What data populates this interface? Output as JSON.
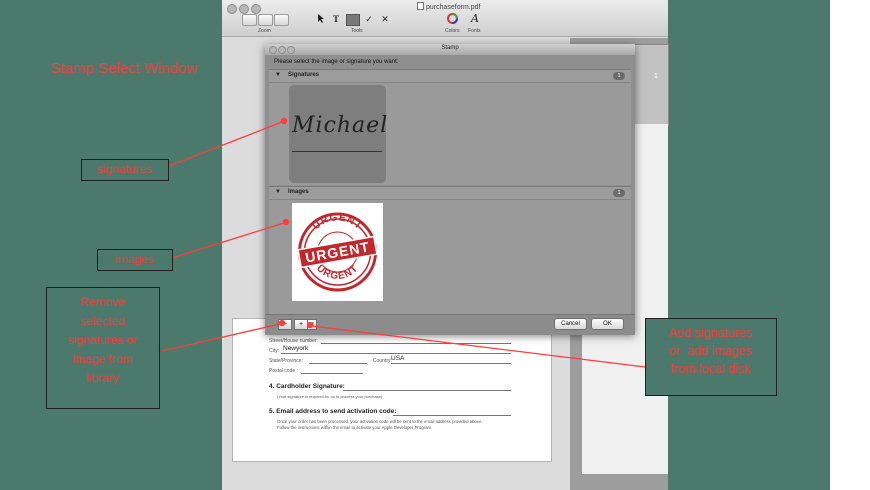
{
  "window": {
    "title": "purchaseform.pdf",
    "toolbar": {
      "zoom_caption": "Zoom",
      "tools_caption": "Tools",
      "colors_caption": "Colors",
      "fonts_caption": "Fonts",
      "text_tool_icon": "T",
      "check_tool_icon": "✓",
      "cross_tool_icon": "✕",
      "fonts_icon": "A"
    },
    "sidebar_page_number": "1"
  },
  "dialog": {
    "title": "Stamp",
    "prompt": "Please select the image or signature you want:",
    "sections": [
      {
        "label": "Signatures",
        "count": "1"
      },
      {
        "label": "Images",
        "count": "1"
      }
    ],
    "signature_text": "Michael",
    "stamp": {
      "top": "URGENT",
      "center": "URGENT",
      "bottom": "URGENT",
      "color": "#c1272d"
    },
    "buttons": {
      "remove": "−",
      "add": "+",
      "cancel": "Cancel",
      "ok": "OK"
    }
  },
  "document": {
    "street_label": "Street/House number:",
    "city_label": "City:",
    "city_value": "Newyork",
    "state_label": "State/Province:",
    "country_label": "Country:",
    "country_value": "USA",
    "postal_label": "Postal code :",
    "section4_title": "4. Cardholder Signature:",
    "section4_note": "(Your signature is required for us to process your purchase)",
    "section5_title": "5. Email address to send activation code:",
    "section5_line1": "Once your order has been processed, your activation code will be sent to the email address provided above.",
    "section5_line2": "Follow the instructions within the email to activate your Apple Developer Program."
  },
  "annotations": {
    "title": "Stamp Select Window",
    "signatures": "signatures",
    "images": "images",
    "remove_lines": [
      "Remove",
      "selected",
      "signatures or",
      "image from",
      "library"
    ],
    "add_lines": [
      "Add signatures",
      "or  add images",
      "from local disk"
    ],
    "color": "#ff3b3b",
    "background": "#4b7a6d"
  }
}
